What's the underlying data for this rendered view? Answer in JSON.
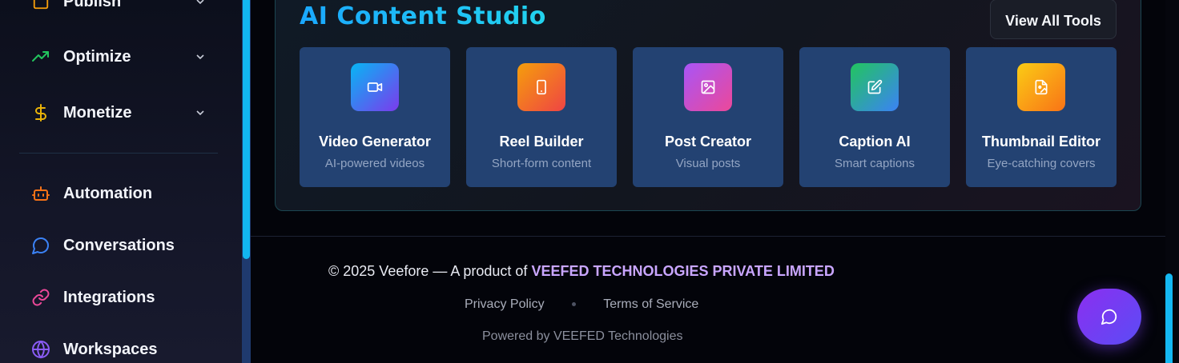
{
  "sidebar": {
    "items": [
      {
        "label": "Publish",
        "icon": "publish-icon",
        "color": "#f59e0b",
        "expandable": true
      },
      {
        "label": "Optimize",
        "icon": "trending-up-icon",
        "color": "#22c55e",
        "expandable": true
      },
      {
        "label": "Monetize",
        "icon": "dollar-icon",
        "color": "#eab308",
        "expandable": true
      },
      {
        "label": "Automation",
        "icon": "bot-icon",
        "color": "#f97316",
        "expandable": false
      },
      {
        "label": "Conversations",
        "icon": "chat-bubble-icon",
        "color": "#3b82f6",
        "expandable": false
      },
      {
        "label": "Integrations",
        "icon": "link-icon",
        "color": "#ec4899",
        "expandable": false
      },
      {
        "label": "Workspaces",
        "icon": "globe-icon",
        "color": "#8b5cf6",
        "expandable": false
      }
    ]
  },
  "studio": {
    "title": "AI Content Studio",
    "view_all_label": "View All Tools",
    "tools": [
      {
        "name": "Video Generator",
        "desc": "AI-powered videos",
        "icon": "video-camera-icon",
        "gradient": [
          "#06b6f4",
          "#7c3aed"
        ]
      },
      {
        "name": "Reel Builder",
        "desc": "Short-form content",
        "icon": "smartphone-icon",
        "gradient": [
          "#f59e0b",
          "#ef4444"
        ]
      },
      {
        "name": "Post Creator",
        "desc": "Visual posts",
        "icon": "image-icon",
        "gradient": [
          "#a855f7",
          "#ec4899"
        ]
      },
      {
        "name": "Caption AI",
        "desc": "Smart captions",
        "icon": "edit-icon",
        "gradient": [
          "#22c55e",
          "#3b82f6"
        ]
      },
      {
        "name": "Thumbnail Editor",
        "desc": "Eye-catching covers",
        "icon": "file-image-icon",
        "gradient": [
          "#facc15",
          "#f97316"
        ]
      }
    ]
  },
  "footer": {
    "copyright_prefix": "© 2025 Veefore — A product of",
    "company": "VEEFED TECHNOLOGIES PRIVATE LIMITED",
    "privacy_label": "Privacy Policy",
    "terms_label": "Terms of Service",
    "powered_by": "Powered by VEEFED Technologies"
  },
  "chat": {
    "icon": "chat-icon"
  }
}
